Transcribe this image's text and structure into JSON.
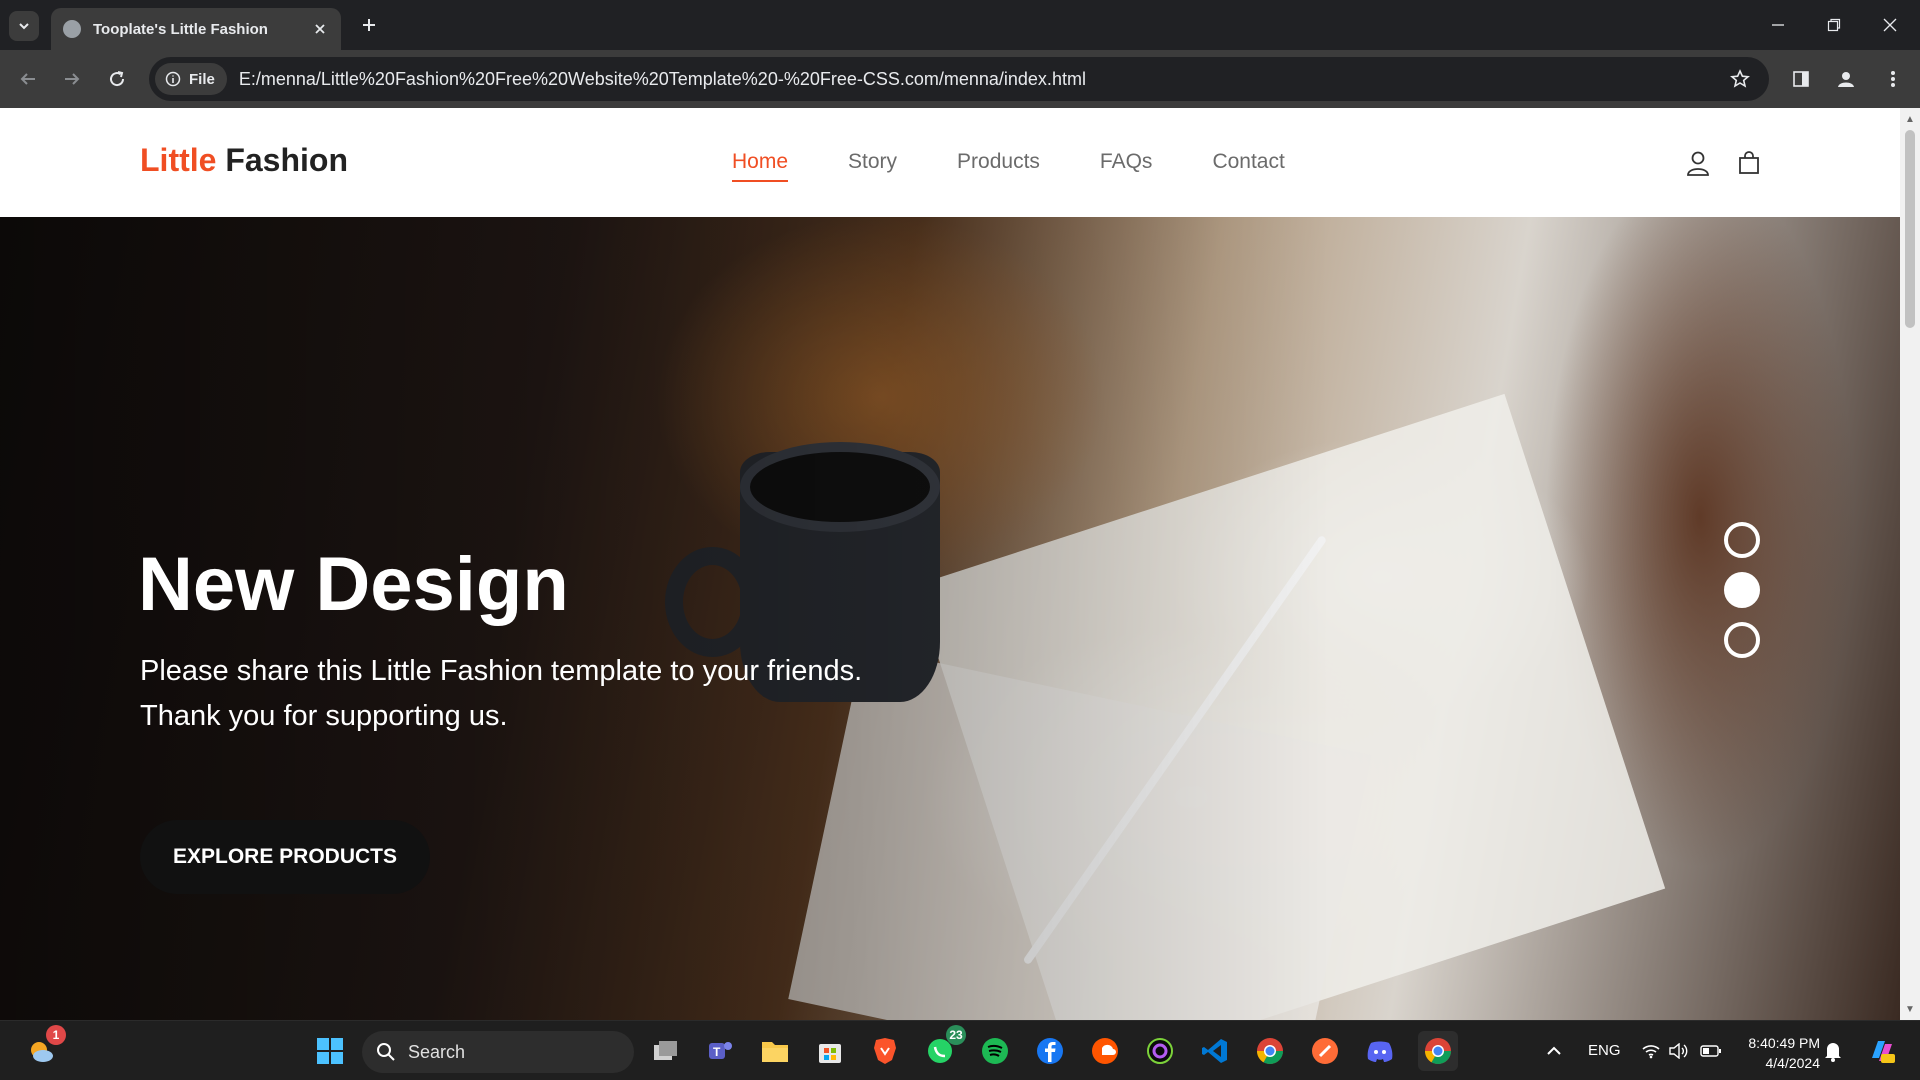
{
  "browser": {
    "tab_title": "Tooplate's Little Fashion",
    "chip_label": "File",
    "url": "E:/menna/Little%20Fashion%20Free%20Website%20Template%20-%20Free-CSS.com/menna/index.html"
  },
  "site": {
    "brand_accent": "Little",
    "brand_rest": " Fashion",
    "nav": [
      "Home",
      "Story",
      "Products",
      "FAQs",
      "Contact"
    ],
    "active_nav": "Home",
    "accent_color": "#f04e23"
  },
  "hero": {
    "title": "New Design",
    "subtitle_line1": "Please share this Little Fashion template to your friends.",
    "subtitle_line2": "Thank you for supporting us.",
    "cta_label": "EXPLORE PRODUCTS",
    "carousel_active": 2,
    "carousel_count": 3
  },
  "taskbar": {
    "search_label": "Search",
    "notification_badge": "1",
    "whatsapp_badge": "23",
    "language": "ENG",
    "time": "8:40:49 PM",
    "date": "4/4/2024"
  }
}
